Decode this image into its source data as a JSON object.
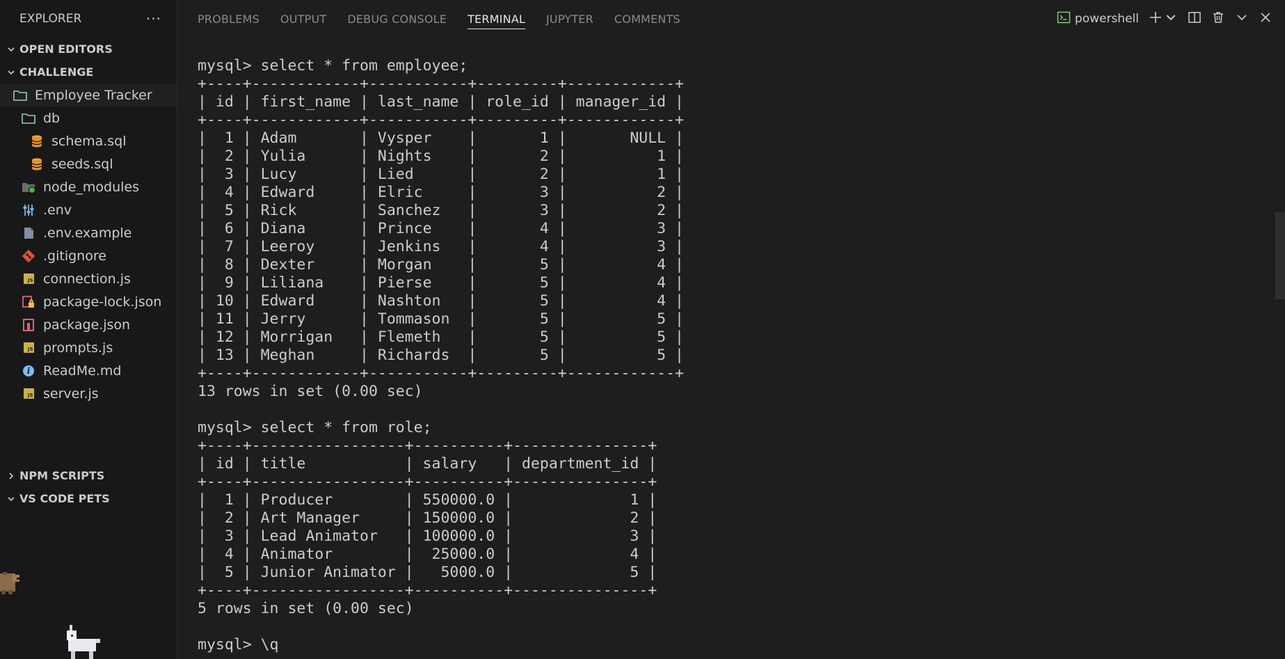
{
  "explorer": {
    "title": "EXPLORER",
    "more": "···",
    "sections": {
      "open_editors": "OPEN EDITORS",
      "challenge": "CHALLENGE",
      "npm_scripts": "NPM SCRIPTS",
      "vscode_pets": "VS CODE PETS"
    },
    "tree": [
      {
        "label": "Employee Tracker",
        "icon": "folder-icon"
      },
      {
        "label": "db",
        "icon": "folder-icon"
      },
      {
        "label": "schema.sql",
        "icon": "database-icon"
      },
      {
        "label": "seeds.sql",
        "icon": "database-icon"
      },
      {
        "label": "node_modules",
        "icon": "node-folder-icon"
      },
      {
        "label": ".env",
        "icon": "settings-sliders-icon"
      },
      {
        "label": ".env.example",
        "icon": "file-icon"
      },
      {
        "label": ".gitignore",
        "icon": "git-icon"
      },
      {
        "label": "connection.js",
        "icon": "js-icon"
      },
      {
        "label": "package-lock.json",
        "icon": "lock-icon"
      },
      {
        "label": "package.json",
        "icon": "npm-icon"
      },
      {
        "label": "prompts.js",
        "icon": "js-icon"
      },
      {
        "label": "ReadMe.md",
        "icon": "info-icon"
      },
      {
        "label": "server.js",
        "icon": "js-icon"
      }
    ]
  },
  "panel": {
    "tabs": [
      "PROBLEMS",
      "OUTPUT",
      "DEBUG CONSOLE",
      "TERMINAL",
      "JUPYTER",
      "COMMENTS"
    ],
    "active_tab": "TERMINAL",
    "shell": "powershell",
    "accent": "#89d185"
  },
  "terminal": {
    "lines": [
      "mysql> select * from employee;",
      "+----+------------+-----------+---------+------------+",
      "| id | first_name | last_name | role_id | manager_id |",
      "+----+------------+-----------+---------+------------+",
      "|  1 | Adam       | Vysper    |       1 |       NULL |",
      "|  2 | Yulia      | Nights    |       2 |          1 |",
      "|  3 | Lucy       | Lied      |       2 |          1 |",
      "|  4 | Edward     | Elric     |       3 |          2 |",
      "|  5 | Rick       | Sanchez   |       3 |          2 |",
      "|  6 | Diana      | Prince    |       4 |          3 |",
      "|  7 | Leeroy     | Jenkins   |       4 |          3 |",
      "|  8 | Dexter     | Morgan    |       5 |          4 |",
      "|  9 | Liliana    | Pierse    |       5 |          4 |",
      "| 10 | Edward     | Nashton   |       5 |          4 |",
      "| 11 | Jerry      | Tommason  |       5 |          5 |",
      "| 12 | Morrigan   | Flemeth   |       5 |          5 |",
      "| 13 | Meghan     | Richards  |       5 |          5 |",
      "+----+------------+-----------+---------+------------+",
      "13 rows in set (0.00 sec)",
      "",
      "mysql> select * from role;",
      "+----+-----------------+----------+---------------+",
      "| id | title           | salary   | department_id |",
      "+----+-----------------+----------+---------------+",
      "|  1 | Producer        | 550000.0 |             1 |",
      "|  2 | Art Manager     | 150000.0 |             2 |",
      "|  3 | Lead Animator   | 100000.0 |             3 |",
      "|  4 | Animator        |  25000.0 |             4 |",
      "|  5 | Junior Animator |   5000.0 |             5 |",
      "+----+-----------------+----------+---------------+",
      "5 rows in set (0.00 sec)",
      "",
      "mysql> \\q"
    ]
  }
}
